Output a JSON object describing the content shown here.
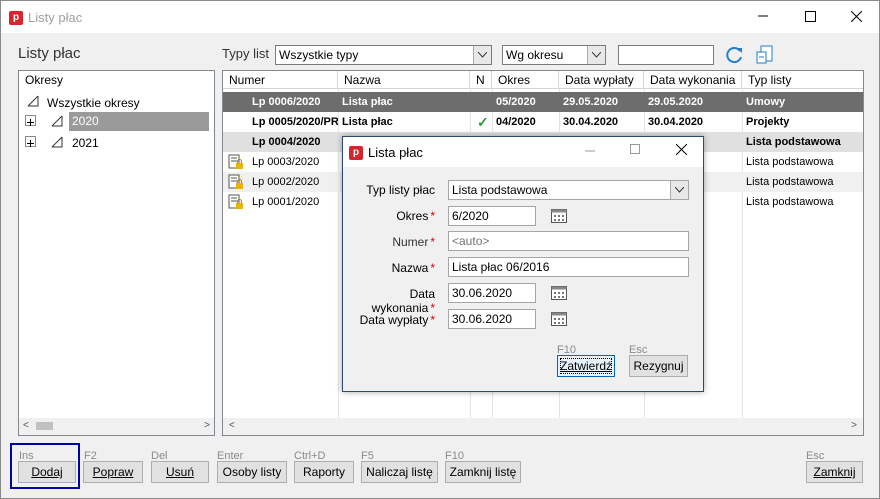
{
  "window": {
    "title": "Listy płac",
    "app_icon": "p"
  },
  "heading": "Listy płac",
  "filter": {
    "types_label": "Typy list",
    "types_value": "Wszystkie typy",
    "period_value": "Wg okresu",
    "search_value": ""
  },
  "tree": {
    "header": "Okresy",
    "items": [
      {
        "label": "Wszystkie okresy"
      },
      {
        "label": "2020"
      },
      {
        "label": "2021"
      }
    ]
  },
  "table": {
    "columns": [
      "Numer",
      "Nazwa",
      "N",
      "Okres",
      "Data wypłaty",
      "Data wykonania",
      "Typ listy"
    ],
    "rows": [
      {
        "numer": "Lp 0006/2020",
        "nazwa": "Lista płac",
        "n": "",
        "okres": "05/2020",
        "wyplata": "29.05.2020",
        "wykonanie": "29.05.2020",
        "typ": "Umowy"
      },
      {
        "numer": "Lp 0005/2020/PR",
        "nazwa": "Lista płac",
        "n": "✓",
        "okres": "04/2020",
        "wyplata": "30.04.2020",
        "wykonanie": "30.04.2020",
        "typ": "Projekty"
      },
      {
        "numer": "Lp 0004/2020",
        "nazwa": "",
        "n": "",
        "okres": "",
        "wyplata": "",
        "wykonanie": "",
        "typ": "Lista podstawowa"
      },
      {
        "numer": "Lp 0003/2020",
        "nazwa": "",
        "n": "",
        "okres": "",
        "wyplata": "",
        "wykonanie": "",
        "typ": "Lista podstawowa"
      },
      {
        "numer": "Lp 0002/2020",
        "nazwa": "",
        "n": "",
        "okres": "",
        "wyplata": "",
        "wykonanie": "",
        "typ": "Lista podstawowa"
      },
      {
        "numer": "Lp 0001/2020",
        "nazwa": "",
        "n": "",
        "okres": "",
        "wyplata": "",
        "wykonanie": "",
        "typ": "Lista podstawowa"
      }
    ]
  },
  "buttons": [
    {
      "key": "Ins",
      "label": "Dodaj"
    },
    {
      "key": "F2",
      "label": "Popraw"
    },
    {
      "key": "Del",
      "label": "Usuń"
    },
    {
      "key": "Enter",
      "label": "Osoby listy"
    },
    {
      "key": "Ctrl+D",
      "label": "Raporty"
    },
    {
      "key": "F5",
      "label": "Naliczaj listę"
    },
    {
      "key": "F10",
      "label": "Zamknij listę"
    },
    {
      "key": "Esc",
      "label": "Zamknij"
    }
  ],
  "dialog": {
    "title": "Lista płac",
    "fields": {
      "typ_label": "Typ listy płac",
      "typ_value": "Lista podstawowa",
      "okres_label": "Okres",
      "okres_value": "6/2020",
      "numer_label": "Numer",
      "numer_placeholder": "<auto>",
      "nazwa_label": "Nazwa",
      "nazwa_value": "Lista płac 06/2016",
      "wykonanie_label": "Data wykonania",
      "wykonanie_value": "30.06.2020",
      "wyplata_label": "Data wypłaty",
      "wyplata_value": "30.06.2020"
    },
    "req_mark": "*",
    "confirm_key": "F10",
    "confirm_label": "Zatwierdź",
    "cancel_key": "Esc",
    "cancel_label": "Rezygnuj"
  },
  "colors": {
    "selected_row": "#6d6d6d",
    "accent": "#0a64ad",
    "focus_border": "#0000aa",
    "logo": "#d9232d"
  }
}
